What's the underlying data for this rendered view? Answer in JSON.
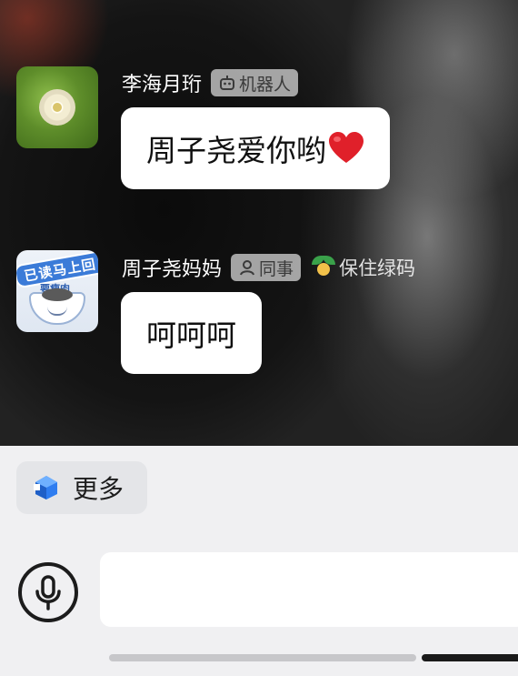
{
  "messages": [
    {
      "sender": "李海月珩",
      "tag_label": "机器人",
      "tag_icon": "robot-icon",
      "text": "周子尧爱你哟",
      "emoji": "red-heart-icon"
    },
    {
      "sender": "周子尧妈妈",
      "tag_label": "同事",
      "tag_icon": "person-icon",
      "extra_label": "保住绿码",
      "extra_icon": "sprout-icon",
      "avatar_sticker_text": "已读马上回",
      "avatar_sticker_sub": "要瘦肉",
      "text": "呵呵呵"
    }
  ],
  "toolbar": {
    "more_label": "更多",
    "more_icon": "cube-icon",
    "mic_icon": "microphone-icon",
    "input_placeholder": ""
  },
  "colors": {
    "bubble": "#ffffff",
    "panel": "#f0f0f2",
    "accent_blue": "#2f7df0",
    "heart": "#e0202a"
  }
}
